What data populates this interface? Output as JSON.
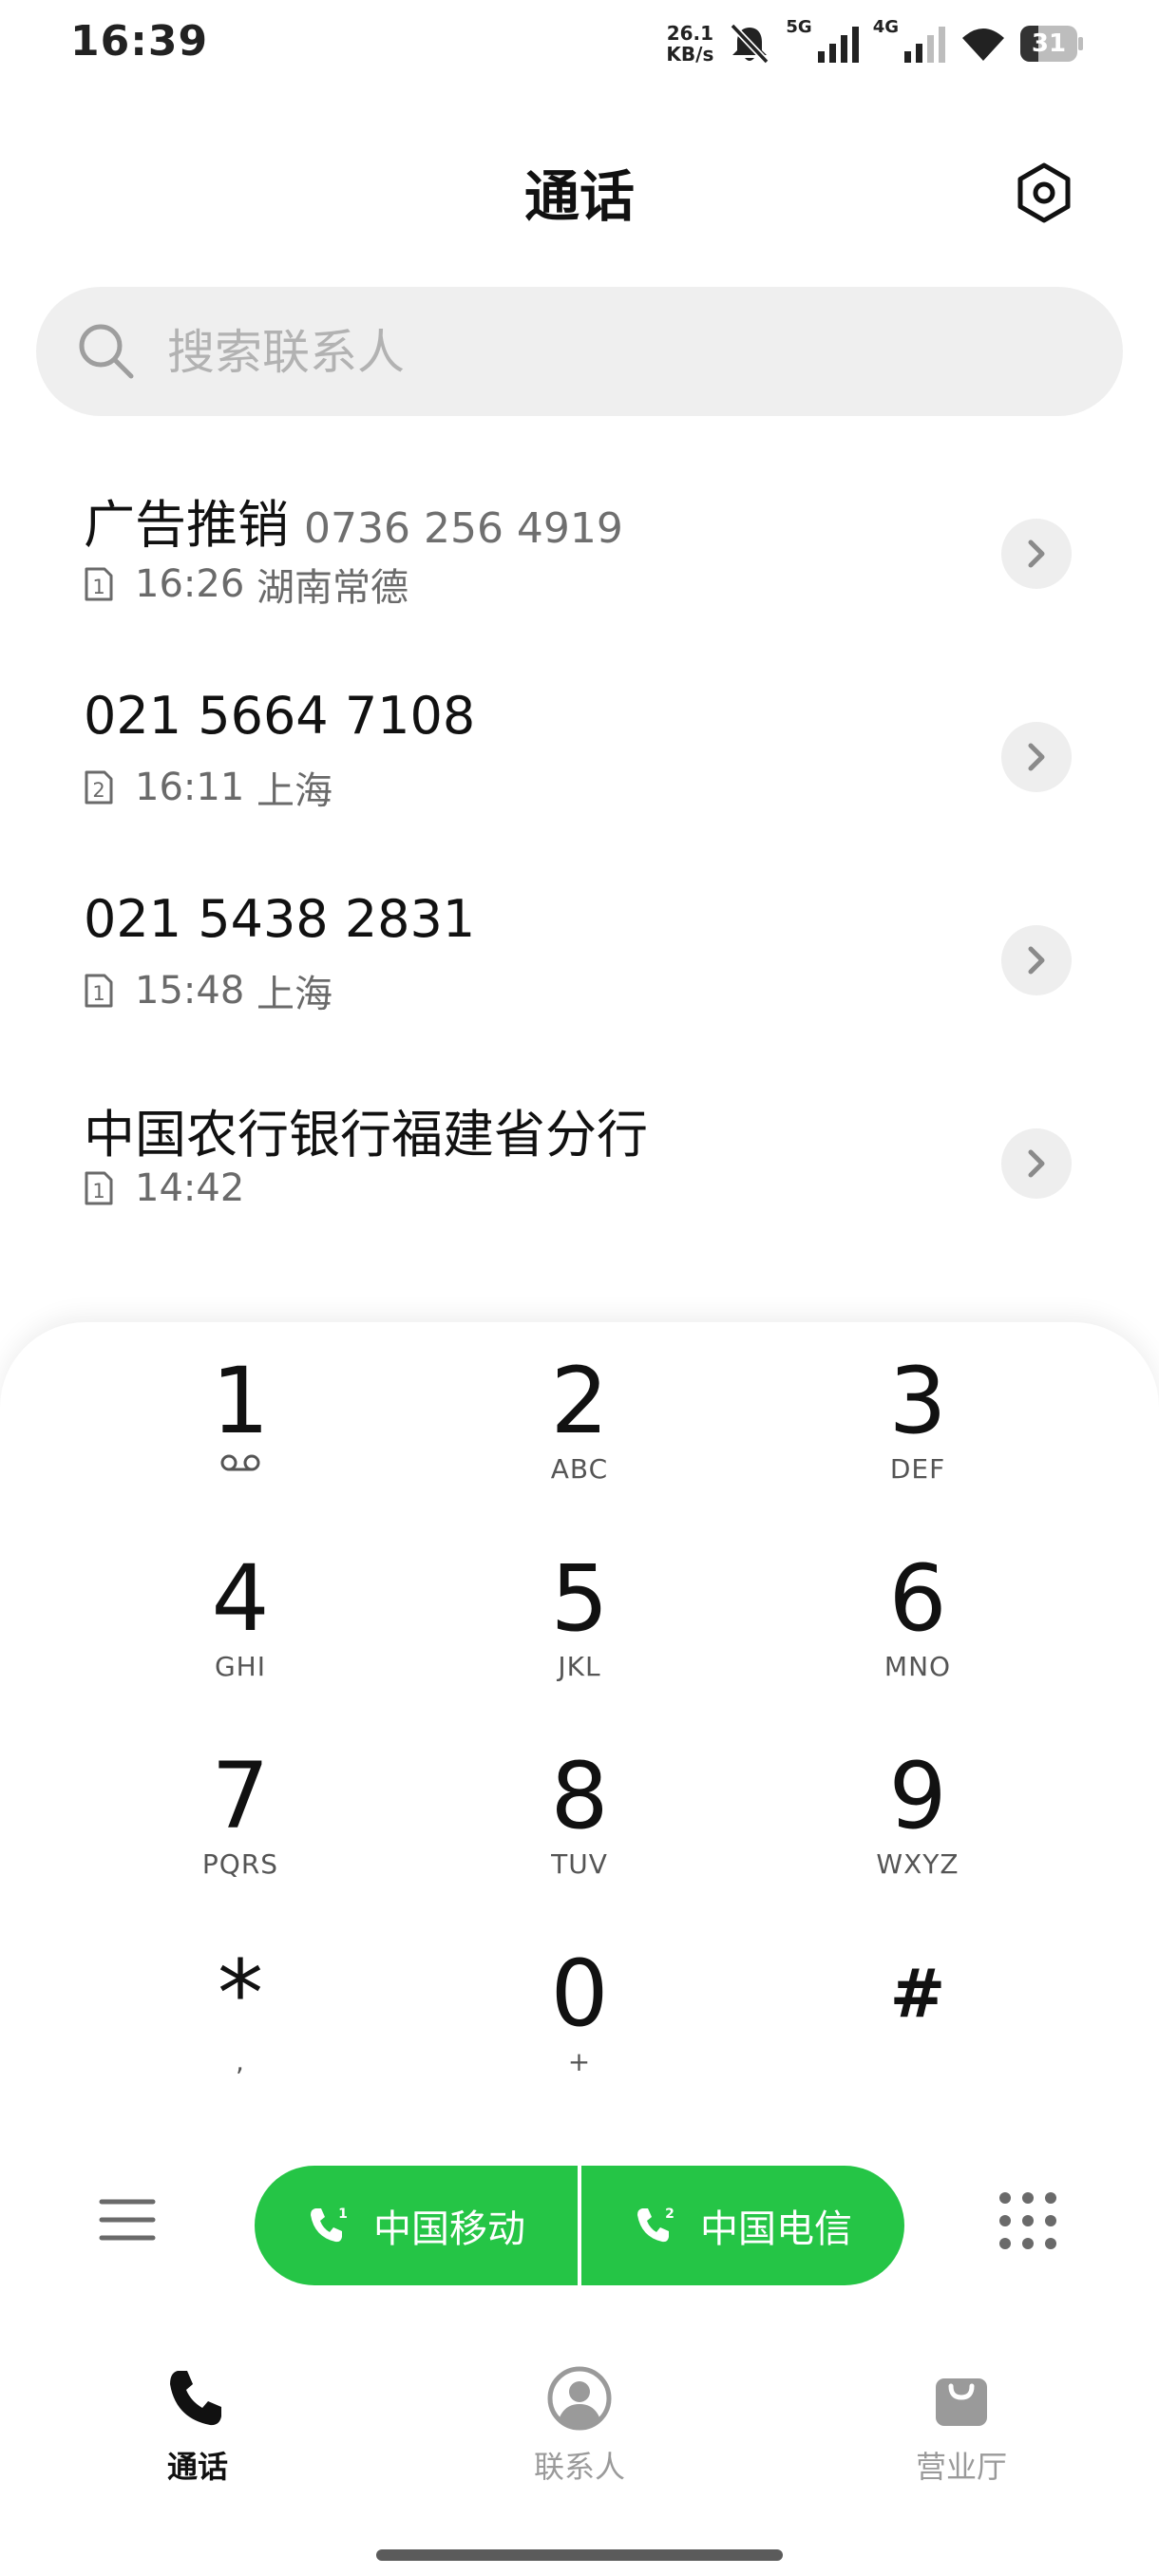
{
  "status_bar": {
    "time": "16:39",
    "net_speed_value": "26.1",
    "net_speed_unit": "KB/s",
    "net_5g": "5G",
    "net_4g": "4G",
    "battery": "31",
    "battery_level_percent": 31
  },
  "header": {
    "title": "通话"
  },
  "search": {
    "placeholder": "搜索联系人",
    "value": ""
  },
  "call_log": [
    {
      "name": "广告推销",
      "number": "0736 256 4919",
      "sim": "1",
      "time": "16:26",
      "location": "湖南常德"
    },
    {
      "name": "021 5664 7108",
      "number": "",
      "sim": "2",
      "time": "16:11",
      "location": "上海"
    },
    {
      "name": "021 5438 2831",
      "number": "",
      "sim": "1",
      "time": "15:48",
      "location": "上海"
    },
    {
      "name": "中国农行银行福建省分行",
      "number": "",
      "sim": "1",
      "time": "14:42",
      "location": ""
    }
  ],
  "dialpad": [
    {
      "digit": "1",
      "letters": ""
    },
    {
      "digit": "2",
      "letters": "ABC"
    },
    {
      "digit": "3",
      "letters": "DEF"
    },
    {
      "digit": "4",
      "letters": "GHI"
    },
    {
      "digit": "5",
      "letters": "JKL"
    },
    {
      "digit": "6",
      "letters": "MNO"
    },
    {
      "digit": "7",
      "letters": "PQRS"
    },
    {
      "digit": "8",
      "letters": "TUV"
    },
    {
      "digit": "9",
      "letters": "WXYZ"
    },
    {
      "digit": "*",
      "letters": ","
    },
    {
      "digit": "0",
      "letters": "+"
    },
    {
      "digit": "#",
      "letters": ""
    }
  ],
  "call_buttons": {
    "sim1_label": "中国移动",
    "sim2_label": "中国电信"
  },
  "bottom_nav": {
    "tabs": [
      {
        "label": "通话",
        "icon": "phone-icon",
        "active": true
      },
      {
        "label": "联系人",
        "icon": "person-icon",
        "active": false
      },
      {
        "label": "营业厅",
        "icon": "shopping-bag-icon",
        "active": false
      }
    ]
  },
  "colors": {
    "accent_green": "#25c546",
    "search_bg": "#efefef"
  }
}
